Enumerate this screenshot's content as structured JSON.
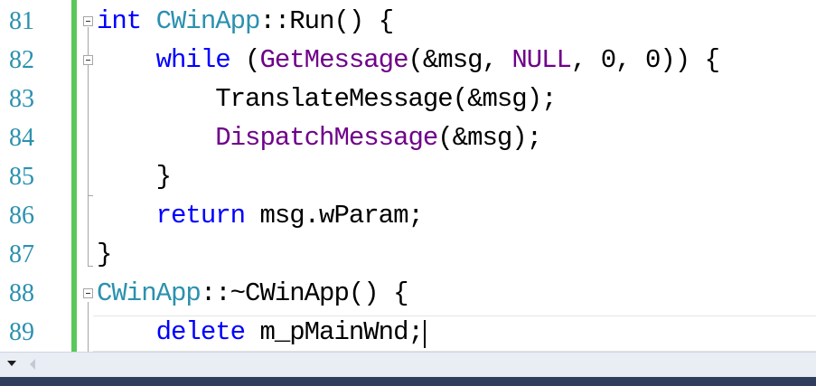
{
  "editor": {
    "line_numbers": [
      "81",
      "82",
      "83",
      "84",
      "85",
      "86",
      "87",
      "88",
      "89"
    ],
    "lines": [
      {
        "number": "81",
        "tokens": [
          {
            "text": "int",
            "kind": "kw"
          },
          {
            "text": " ",
            "kind": "plain"
          },
          {
            "text": "CWinApp",
            "kind": "type"
          },
          {
            "text": "::",
            "kind": "plain"
          },
          {
            "text": "Run",
            "kind": "plain"
          },
          {
            "text": "() {",
            "kind": "plain"
          }
        ]
      },
      {
        "number": "82",
        "tokens": [
          {
            "text": "    ",
            "kind": "plain"
          },
          {
            "text": "while",
            "kind": "kw"
          },
          {
            "text": " (",
            "kind": "plain"
          },
          {
            "text": "GetMessage",
            "kind": "macro"
          },
          {
            "text": "(&msg, ",
            "kind": "plain"
          },
          {
            "text": "NULL",
            "kind": "macro"
          },
          {
            "text": ", 0, 0)) {",
            "kind": "plain"
          }
        ]
      },
      {
        "number": "83",
        "tokens": [
          {
            "text": "        ",
            "kind": "plain"
          },
          {
            "text": "TranslateMessage",
            "kind": "plain"
          },
          {
            "text": "(&msg);",
            "kind": "plain"
          }
        ]
      },
      {
        "number": "84",
        "tokens": [
          {
            "text": "        ",
            "kind": "plain"
          },
          {
            "text": "DispatchMessage",
            "kind": "macro"
          },
          {
            "text": "(&msg);",
            "kind": "plain"
          }
        ]
      },
      {
        "number": "85",
        "tokens": [
          {
            "text": "    }",
            "kind": "plain"
          }
        ]
      },
      {
        "number": "86",
        "tokens": [
          {
            "text": "    ",
            "kind": "plain"
          },
          {
            "text": "return",
            "kind": "kw"
          },
          {
            "text": " msg.wParam;",
            "kind": "plain"
          }
        ]
      },
      {
        "number": "87",
        "tokens": [
          {
            "text": "}",
            "kind": "plain"
          }
        ]
      },
      {
        "number": "88",
        "tokens": [
          {
            "text": "CWinApp",
            "kind": "type"
          },
          {
            "text": "::~",
            "kind": "plain"
          },
          {
            "text": "CWinApp",
            "kind": "plain"
          },
          {
            "text": "() {",
            "kind": "plain"
          }
        ]
      },
      {
        "number": "89",
        "tokens": [
          {
            "text": "    ",
            "kind": "plain"
          },
          {
            "text": "delete",
            "kind": "kw"
          },
          {
            "text": " m_pMainWnd;",
            "kind": "plain"
          }
        ]
      }
    ]
  },
  "colors": {
    "keyword": "#0000ff",
    "type": "#2b91af",
    "macro": "#6f008a",
    "line_number": "#2b91af",
    "change_bar": "#59c85a"
  },
  "icons": {
    "collapse": "collapse-minus-icon",
    "zoom_dropdown": "chevron-down-icon",
    "scroll_left": "scroll-left-arrow-icon"
  }
}
